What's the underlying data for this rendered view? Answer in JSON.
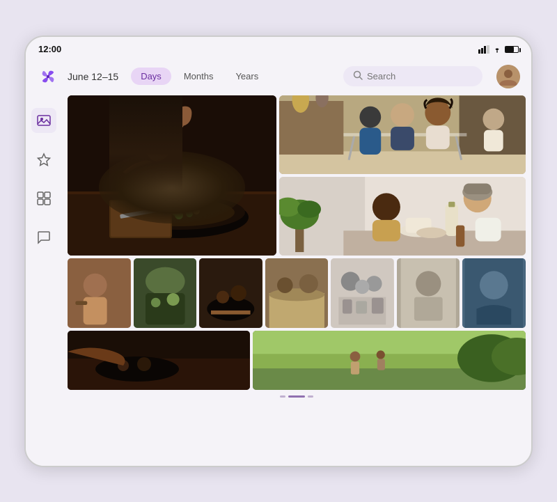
{
  "statusBar": {
    "time": "12:00"
  },
  "toolbar": {
    "dateRange": "June 12–15",
    "tabs": [
      {
        "label": "Days",
        "active": true
      },
      {
        "label": "Months",
        "active": false
      },
      {
        "label": "Years",
        "active": false
      }
    ],
    "searchPlaceholder": "Search"
  },
  "sideNav": {
    "icons": [
      {
        "name": "photos-icon",
        "active": true,
        "glyph": "🖼"
      },
      {
        "name": "favorites-icon",
        "active": false,
        "glyph": "☆"
      },
      {
        "name": "albums-icon",
        "active": false,
        "glyph": "⊞"
      },
      {
        "name": "messages-icon",
        "active": false,
        "glyph": "💬"
      }
    ]
  },
  "scrollIndicator": {
    "dots": [
      {
        "active": false
      },
      {
        "active": true
      },
      {
        "active": false
      }
    ]
  }
}
